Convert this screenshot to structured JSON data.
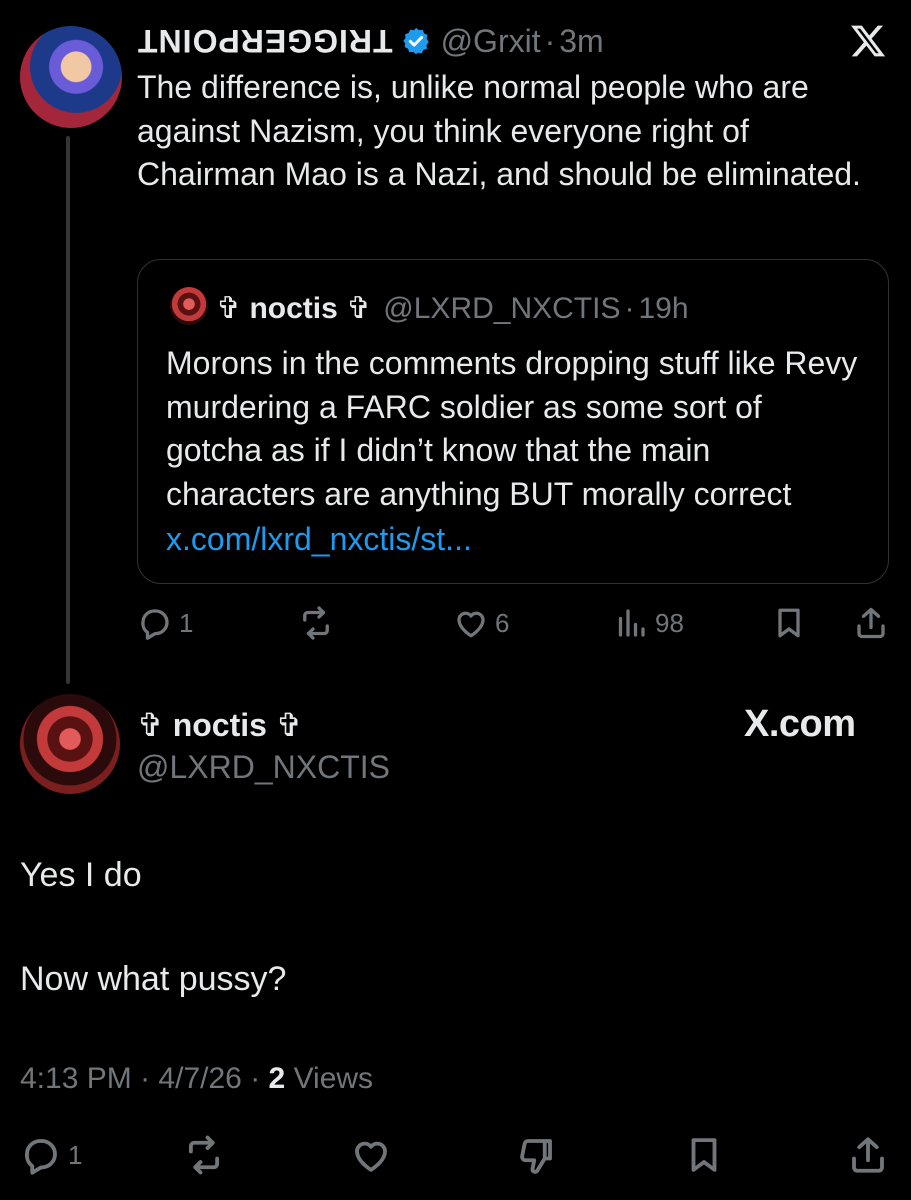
{
  "top_tweet": {
    "display_name": "TRIGGERPOINT",
    "verified": true,
    "handle": "@Grxit",
    "separator": "·",
    "time": "3m",
    "text": "The difference is, unlike normal people who are against Nazism, you think everyone right of Chairman Mao is a Nazi, and should be eliminated.",
    "quoted": {
      "display_name": "✞ noctis ✞",
      "handle": "@LXRD_NXCTIS",
      "separator": "·",
      "time": "19h",
      "text": "Morons in the comments dropping stuff like Revy murdering a FARC soldier as some sort of gotcha as if I didn’t know that the main characters are anything BUT morally correct",
      "link": "x.com/lxrd_nxctis/st..."
    },
    "actions": {
      "replies": "1",
      "reposts": "",
      "likes": "6",
      "views": "98"
    }
  },
  "reply_tweet": {
    "display_name": "✞ noctis ✞",
    "handle": "@LXRD_NXCTIS",
    "watermark": "X.com",
    "line1": "Yes I do",
    "line2": "Now what pussy?",
    "meta": {
      "time": "4:13 PM",
      "date": "4/7/26",
      "separator": "·",
      "views_count": "2",
      "views_label": "Views"
    },
    "actions": {
      "replies": "1"
    }
  },
  "icons": {
    "x_logo": "x-logo-icon",
    "verified": "verified-badge-icon",
    "reply": "reply-icon",
    "repost": "repost-icon",
    "like": "heart-icon",
    "views": "views-icon",
    "bookmark": "bookmark-icon",
    "share": "share-icon",
    "dislike": "dislike-icon"
  },
  "colors": {
    "background": "#000000",
    "text": "#e7e9ea",
    "muted": "#71767b",
    "link": "#1d9bf0",
    "verified": "#1d9bf0",
    "border": "#2f3336"
  }
}
